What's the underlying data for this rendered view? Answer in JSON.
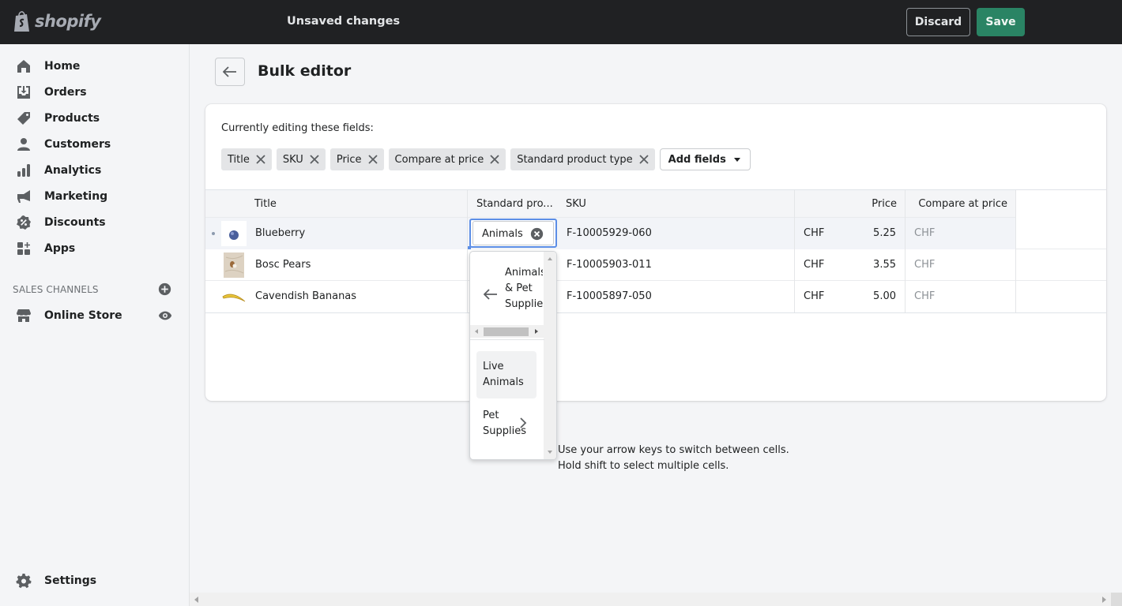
{
  "topbar": {
    "brand": "shopify",
    "status": "Unsaved changes",
    "discard_label": "Discard",
    "save_label": "Save",
    "save_color": "#2a8464"
  },
  "sidebar": {
    "items": [
      {
        "label": "Home",
        "icon": "home-icon"
      },
      {
        "label": "Orders",
        "icon": "orders-icon"
      },
      {
        "label": "Products",
        "icon": "tag-icon"
      },
      {
        "label": "Customers",
        "icon": "person-icon"
      },
      {
        "label": "Analytics",
        "icon": "bar-chart-icon"
      },
      {
        "label": "Marketing",
        "icon": "megaphone-icon"
      },
      {
        "label": "Discounts",
        "icon": "discount-icon"
      },
      {
        "label": "Apps",
        "icon": "apps-icon"
      }
    ],
    "sales_channels_title": "SALES CHANNELS",
    "channels": [
      {
        "label": "Online Store",
        "icon": "store-icon"
      }
    ],
    "settings_label": "Settings"
  },
  "page": {
    "title": "Bulk editor",
    "editing_label": "Currently editing these fields:",
    "fields": [
      "Title",
      "SKU",
      "Price",
      "Compare at price",
      "Standard product type"
    ],
    "add_fields_label": "Add fields"
  },
  "table": {
    "headers": {
      "title": "Title",
      "product_type": "Standard pro...",
      "sku": "SKU",
      "price": "Price",
      "compare_at_price": "Compare at price"
    },
    "rows": [
      {
        "title": "Blueberry",
        "product_type": "Animals",
        "sku": "F-10005929-060",
        "currency": "CHF",
        "price": "5.25",
        "compare_currency": "CHF",
        "selected": true
      },
      {
        "title": "Bosc Pears",
        "product_type": "",
        "sku": "F-10005903-011",
        "currency": "CHF",
        "price": "3.55",
        "compare_currency": "CHF",
        "selected": false
      },
      {
        "title": "Cavendish Bananas",
        "product_type": "",
        "sku": "F-10005897-050",
        "currency": "CHF",
        "price": "5.00",
        "compare_currency": "CHF",
        "selected": false
      }
    ]
  },
  "dropdown": {
    "parent": "Animals & Pet Supplies",
    "options": [
      {
        "label": "Live Animals",
        "has_children": false
      },
      {
        "label": "Pet Supplies",
        "has_children": true
      }
    ]
  },
  "hint": {
    "line1": "Use your arrow keys to switch between cells.",
    "line2": "Hold shift to select multiple cells."
  }
}
